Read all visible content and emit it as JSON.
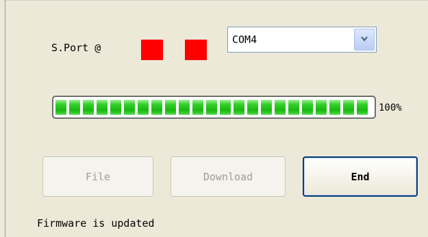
{
  "port": {
    "label": "S.Port @",
    "indicator_color": "#ff0000",
    "selected": "COM4"
  },
  "progress": {
    "percent_value": 100,
    "label": "100%",
    "fill_color": "#22c418"
  },
  "buttons": {
    "file_label": "File",
    "download_label": "Download",
    "end_label": "End"
  },
  "status": {
    "message": "Firmware is updated"
  }
}
